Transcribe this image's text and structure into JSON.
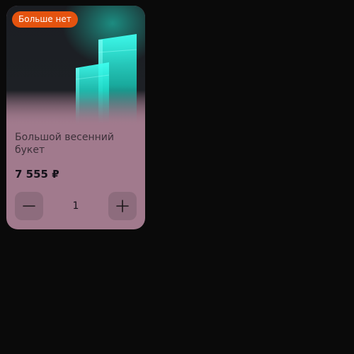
{
  "product_card": {
    "badge": "Больше нет",
    "name": "Большой весенний букет",
    "price": "7 555 ₽",
    "quantity": "1",
    "image_icon": "glowing-blocks-image"
  },
  "colors": {
    "card_background": "#a17a8d",
    "badge_background": "#e4530f",
    "accent_glow": "#1ee6cd",
    "page_background": "#0a0a0a"
  }
}
